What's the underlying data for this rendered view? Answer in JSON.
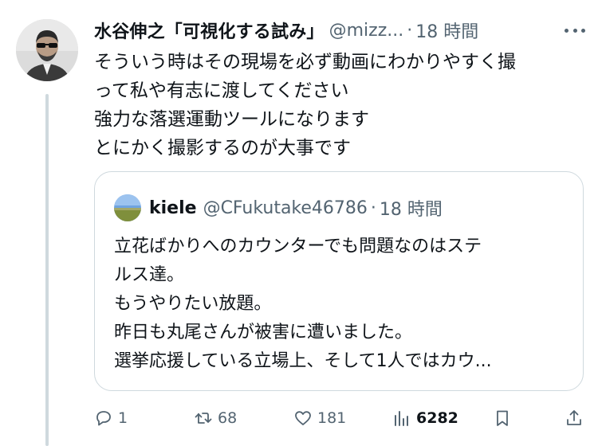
{
  "tweet": {
    "author": "水谷伸之「可視化する試み」",
    "handle": "@mizz...",
    "separator": "·",
    "time": "18 時間",
    "lines": [
      "そういう時はその現場を必ず動画にわかりやすく撮",
      "って私や有志に渡してください",
      "強力な落選運動ツールになります",
      "とにかく撮影するのが大事です"
    ]
  },
  "quote": {
    "author": "kiele",
    "handle": "@CFukutake46786",
    "separator": "·",
    "time": "18 時間",
    "lines": [
      "立花ばかりへのカウンターでも問題なのはステ",
      "ルス達。",
      "もうやりたい放題。",
      "昨日も丸尾さんが被害に遭いました。",
      "選挙応援している立場上、そして1人ではカウ..."
    ]
  },
  "actions": {
    "replies": "1",
    "retweets": "68",
    "likes": "181",
    "views": "6282"
  },
  "icons": {
    "reply": "reply-icon",
    "retweet": "retweet-icon",
    "like": "heart-icon",
    "views": "views-chart-icon",
    "bookmark": "bookmark-icon",
    "share": "share-icon",
    "more": "more-dots-icon"
  },
  "colors": {
    "text": "#0f1419",
    "secondary": "#536471",
    "border": "#cfd9de"
  }
}
